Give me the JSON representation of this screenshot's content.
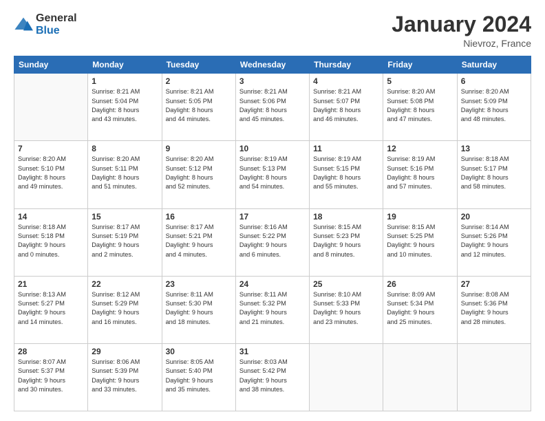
{
  "logo": {
    "general": "General",
    "blue": "Blue"
  },
  "title": "January 2024",
  "location": "Nievroz, France",
  "days_of_week": [
    "Sunday",
    "Monday",
    "Tuesday",
    "Wednesday",
    "Thursday",
    "Friday",
    "Saturday"
  ],
  "weeks": [
    [
      {
        "day": "",
        "info": ""
      },
      {
        "day": "1",
        "info": "Sunrise: 8:21 AM\nSunset: 5:04 PM\nDaylight: 8 hours\nand 43 minutes."
      },
      {
        "day": "2",
        "info": "Sunrise: 8:21 AM\nSunset: 5:05 PM\nDaylight: 8 hours\nand 44 minutes."
      },
      {
        "day": "3",
        "info": "Sunrise: 8:21 AM\nSunset: 5:06 PM\nDaylight: 8 hours\nand 45 minutes."
      },
      {
        "day": "4",
        "info": "Sunrise: 8:21 AM\nSunset: 5:07 PM\nDaylight: 8 hours\nand 46 minutes."
      },
      {
        "day": "5",
        "info": "Sunrise: 8:20 AM\nSunset: 5:08 PM\nDaylight: 8 hours\nand 47 minutes."
      },
      {
        "day": "6",
        "info": "Sunrise: 8:20 AM\nSunset: 5:09 PM\nDaylight: 8 hours\nand 48 minutes."
      }
    ],
    [
      {
        "day": "7",
        "info": "Sunrise: 8:20 AM\nSunset: 5:10 PM\nDaylight: 8 hours\nand 49 minutes."
      },
      {
        "day": "8",
        "info": "Sunrise: 8:20 AM\nSunset: 5:11 PM\nDaylight: 8 hours\nand 51 minutes."
      },
      {
        "day": "9",
        "info": "Sunrise: 8:20 AM\nSunset: 5:12 PM\nDaylight: 8 hours\nand 52 minutes."
      },
      {
        "day": "10",
        "info": "Sunrise: 8:19 AM\nSunset: 5:13 PM\nDaylight: 8 hours\nand 54 minutes."
      },
      {
        "day": "11",
        "info": "Sunrise: 8:19 AM\nSunset: 5:15 PM\nDaylight: 8 hours\nand 55 minutes."
      },
      {
        "day": "12",
        "info": "Sunrise: 8:19 AM\nSunset: 5:16 PM\nDaylight: 8 hours\nand 57 minutes."
      },
      {
        "day": "13",
        "info": "Sunrise: 8:18 AM\nSunset: 5:17 PM\nDaylight: 8 hours\nand 58 minutes."
      }
    ],
    [
      {
        "day": "14",
        "info": "Sunrise: 8:18 AM\nSunset: 5:18 PM\nDaylight: 9 hours\nand 0 minutes."
      },
      {
        "day": "15",
        "info": "Sunrise: 8:17 AM\nSunset: 5:19 PM\nDaylight: 9 hours\nand 2 minutes."
      },
      {
        "day": "16",
        "info": "Sunrise: 8:17 AM\nSunset: 5:21 PM\nDaylight: 9 hours\nand 4 minutes."
      },
      {
        "day": "17",
        "info": "Sunrise: 8:16 AM\nSunset: 5:22 PM\nDaylight: 9 hours\nand 6 minutes."
      },
      {
        "day": "18",
        "info": "Sunrise: 8:15 AM\nSunset: 5:23 PM\nDaylight: 9 hours\nand 8 minutes."
      },
      {
        "day": "19",
        "info": "Sunrise: 8:15 AM\nSunset: 5:25 PM\nDaylight: 9 hours\nand 10 minutes."
      },
      {
        "day": "20",
        "info": "Sunrise: 8:14 AM\nSunset: 5:26 PM\nDaylight: 9 hours\nand 12 minutes."
      }
    ],
    [
      {
        "day": "21",
        "info": "Sunrise: 8:13 AM\nSunset: 5:27 PM\nDaylight: 9 hours\nand 14 minutes."
      },
      {
        "day": "22",
        "info": "Sunrise: 8:12 AM\nSunset: 5:29 PM\nDaylight: 9 hours\nand 16 minutes."
      },
      {
        "day": "23",
        "info": "Sunrise: 8:11 AM\nSunset: 5:30 PM\nDaylight: 9 hours\nand 18 minutes."
      },
      {
        "day": "24",
        "info": "Sunrise: 8:11 AM\nSunset: 5:32 PM\nDaylight: 9 hours\nand 21 minutes."
      },
      {
        "day": "25",
        "info": "Sunrise: 8:10 AM\nSunset: 5:33 PM\nDaylight: 9 hours\nand 23 minutes."
      },
      {
        "day": "26",
        "info": "Sunrise: 8:09 AM\nSunset: 5:34 PM\nDaylight: 9 hours\nand 25 minutes."
      },
      {
        "day": "27",
        "info": "Sunrise: 8:08 AM\nSunset: 5:36 PM\nDaylight: 9 hours\nand 28 minutes."
      }
    ],
    [
      {
        "day": "28",
        "info": "Sunrise: 8:07 AM\nSunset: 5:37 PM\nDaylight: 9 hours\nand 30 minutes."
      },
      {
        "day": "29",
        "info": "Sunrise: 8:06 AM\nSunset: 5:39 PM\nDaylight: 9 hours\nand 33 minutes."
      },
      {
        "day": "30",
        "info": "Sunrise: 8:05 AM\nSunset: 5:40 PM\nDaylight: 9 hours\nand 35 minutes."
      },
      {
        "day": "31",
        "info": "Sunrise: 8:03 AM\nSunset: 5:42 PM\nDaylight: 9 hours\nand 38 minutes."
      },
      {
        "day": "",
        "info": ""
      },
      {
        "day": "",
        "info": ""
      },
      {
        "day": "",
        "info": ""
      }
    ]
  ]
}
